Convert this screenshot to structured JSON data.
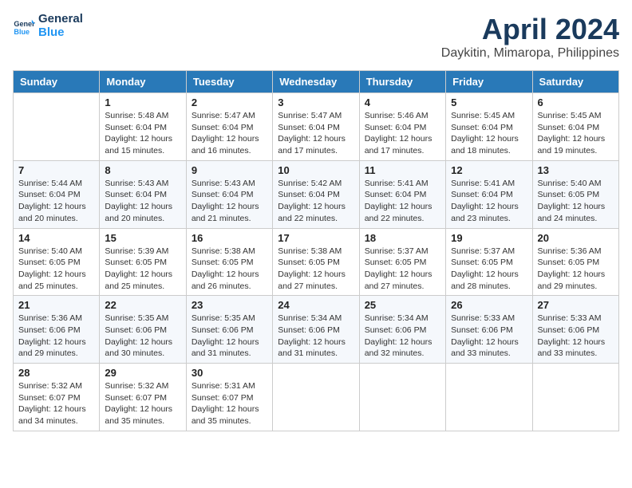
{
  "header": {
    "logo_line1": "General",
    "logo_line2": "Blue",
    "month": "April 2024",
    "location": "Daykitin, Mimaropa, Philippines"
  },
  "weekdays": [
    "Sunday",
    "Monday",
    "Tuesday",
    "Wednesday",
    "Thursday",
    "Friday",
    "Saturday"
  ],
  "weeks": [
    [
      {
        "day": "",
        "sunrise": "",
        "sunset": "",
        "daylight": ""
      },
      {
        "day": "1",
        "sunrise": "5:48 AM",
        "sunset": "6:04 PM",
        "daylight": "12 hours and 15 minutes."
      },
      {
        "day": "2",
        "sunrise": "5:47 AM",
        "sunset": "6:04 PM",
        "daylight": "12 hours and 16 minutes."
      },
      {
        "day": "3",
        "sunrise": "5:47 AM",
        "sunset": "6:04 PM",
        "daylight": "12 hours and 17 minutes."
      },
      {
        "day": "4",
        "sunrise": "5:46 AM",
        "sunset": "6:04 PM",
        "daylight": "12 hours and 17 minutes."
      },
      {
        "day": "5",
        "sunrise": "5:45 AM",
        "sunset": "6:04 PM",
        "daylight": "12 hours and 18 minutes."
      },
      {
        "day": "6",
        "sunrise": "5:45 AM",
        "sunset": "6:04 PM",
        "daylight": "12 hours and 19 minutes."
      }
    ],
    [
      {
        "day": "7",
        "sunrise": "5:44 AM",
        "sunset": "6:04 PM",
        "daylight": "12 hours and 20 minutes."
      },
      {
        "day": "8",
        "sunrise": "5:43 AM",
        "sunset": "6:04 PM",
        "daylight": "12 hours and 20 minutes."
      },
      {
        "day": "9",
        "sunrise": "5:43 AM",
        "sunset": "6:04 PM",
        "daylight": "12 hours and 21 minutes."
      },
      {
        "day": "10",
        "sunrise": "5:42 AM",
        "sunset": "6:04 PM",
        "daylight": "12 hours and 22 minutes."
      },
      {
        "day": "11",
        "sunrise": "5:41 AM",
        "sunset": "6:04 PM",
        "daylight": "12 hours and 22 minutes."
      },
      {
        "day": "12",
        "sunrise": "5:41 AM",
        "sunset": "6:04 PM",
        "daylight": "12 hours and 23 minutes."
      },
      {
        "day": "13",
        "sunrise": "5:40 AM",
        "sunset": "6:05 PM",
        "daylight": "12 hours and 24 minutes."
      }
    ],
    [
      {
        "day": "14",
        "sunrise": "5:40 AM",
        "sunset": "6:05 PM",
        "daylight": "12 hours and 25 minutes."
      },
      {
        "day": "15",
        "sunrise": "5:39 AM",
        "sunset": "6:05 PM",
        "daylight": "12 hours and 25 minutes."
      },
      {
        "day": "16",
        "sunrise": "5:38 AM",
        "sunset": "6:05 PM",
        "daylight": "12 hours and 26 minutes."
      },
      {
        "day": "17",
        "sunrise": "5:38 AM",
        "sunset": "6:05 PM",
        "daylight": "12 hours and 27 minutes."
      },
      {
        "day": "18",
        "sunrise": "5:37 AM",
        "sunset": "6:05 PM",
        "daylight": "12 hours and 27 minutes."
      },
      {
        "day": "19",
        "sunrise": "5:37 AM",
        "sunset": "6:05 PM",
        "daylight": "12 hours and 28 minutes."
      },
      {
        "day": "20",
        "sunrise": "5:36 AM",
        "sunset": "6:05 PM",
        "daylight": "12 hours and 29 minutes."
      }
    ],
    [
      {
        "day": "21",
        "sunrise": "5:36 AM",
        "sunset": "6:06 PM",
        "daylight": "12 hours and 29 minutes."
      },
      {
        "day": "22",
        "sunrise": "5:35 AM",
        "sunset": "6:06 PM",
        "daylight": "12 hours and 30 minutes."
      },
      {
        "day": "23",
        "sunrise": "5:35 AM",
        "sunset": "6:06 PM",
        "daylight": "12 hours and 31 minutes."
      },
      {
        "day": "24",
        "sunrise": "5:34 AM",
        "sunset": "6:06 PM",
        "daylight": "12 hours and 31 minutes."
      },
      {
        "day": "25",
        "sunrise": "5:34 AM",
        "sunset": "6:06 PM",
        "daylight": "12 hours and 32 minutes."
      },
      {
        "day": "26",
        "sunrise": "5:33 AM",
        "sunset": "6:06 PM",
        "daylight": "12 hours and 33 minutes."
      },
      {
        "day": "27",
        "sunrise": "5:33 AM",
        "sunset": "6:06 PM",
        "daylight": "12 hours and 33 minutes."
      }
    ],
    [
      {
        "day": "28",
        "sunrise": "5:32 AM",
        "sunset": "6:07 PM",
        "daylight": "12 hours and 34 minutes."
      },
      {
        "day": "29",
        "sunrise": "5:32 AM",
        "sunset": "6:07 PM",
        "daylight": "12 hours and 35 minutes."
      },
      {
        "day": "30",
        "sunrise": "5:31 AM",
        "sunset": "6:07 PM",
        "daylight": "12 hours and 35 minutes."
      },
      {
        "day": "",
        "sunrise": "",
        "sunset": "",
        "daylight": ""
      },
      {
        "day": "",
        "sunrise": "",
        "sunset": "",
        "daylight": ""
      },
      {
        "day": "",
        "sunrise": "",
        "sunset": "",
        "daylight": ""
      },
      {
        "day": "",
        "sunrise": "",
        "sunset": "",
        "daylight": ""
      }
    ]
  ]
}
